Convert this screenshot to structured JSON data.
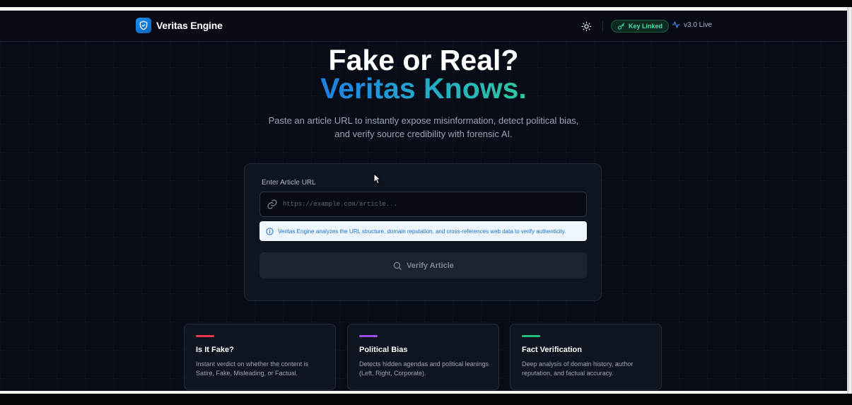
{
  "app": {
    "title": "Veritas Engine",
    "version": "v3.0 Live",
    "key_status": "Key Linked"
  },
  "hero": {
    "title_line1": "Fake or Real?",
    "title_line2": "Veritas Knows.",
    "subtitle": "Paste an article URL to instantly expose misinformation, detect political bias, and verify source credibility with forensic AI."
  },
  "form": {
    "label": "Enter Article URL",
    "placeholder": "https://example.com/article...",
    "value": "",
    "info": "Veritas Engine analyzes the URL structure, domain reputation, and cross-references web data to verify authenticity.",
    "button_label": "Verify Article"
  },
  "features": [
    {
      "title": "Is It Fake?",
      "description": "Instant verdict on whether the content is Satire, Fake, Misleading, or Factual.",
      "accent": "#e8364f"
    },
    {
      "title": "Political Bias",
      "description": "Detects hidden agendas and political leanings (Left, Right, Corporate).",
      "accent": "#9b4dea"
    },
    {
      "title": "Fact Verification",
      "description": "Deep analysis of domain history, author reputation, and factual accuracy.",
      "accent": "#1fbf7a"
    }
  ],
  "colors": {
    "background": "#080c16",
    "brand": "#1c8ff0",
    "gradient_start": "#1e7fe6",
    "gradient_end": "#2dc9a0",
    "key_badge": "#4ee0a2"
  },
  "icons": {
    "logo": "shield-check-icon",
    "theme": "sun-icon",
    "key": "key-icon",
    "version": "activity-icon",
    "input": "link-icon",
    "info": "info-icon",
    "button": "search-icon"
  }
}
